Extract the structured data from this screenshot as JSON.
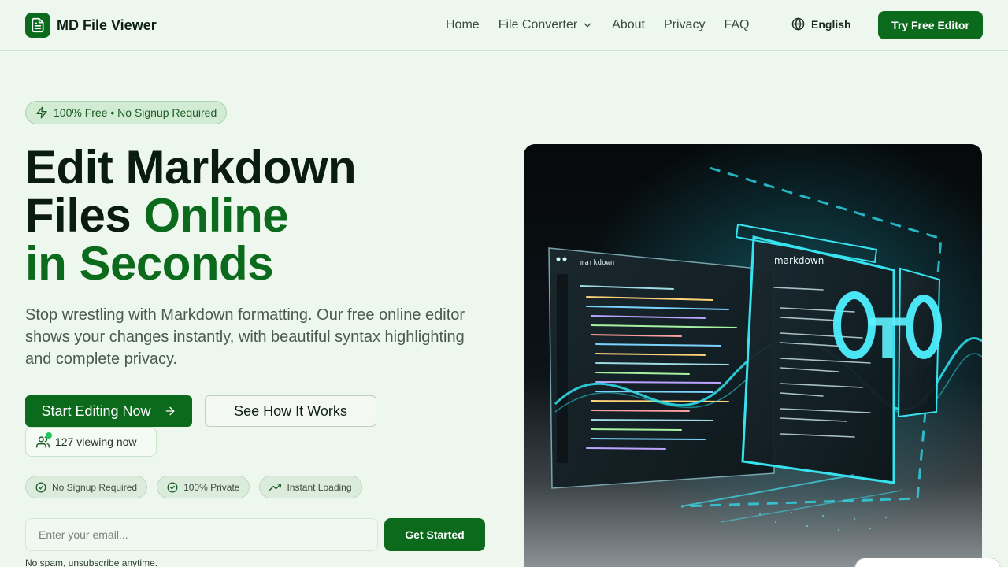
{
  "header": {
    "brand": "MD File Viewer",
    "nav": [
      {
        "label": "Home"
      },
      {
        "label": "File Converter",
        "has_dropdown": true
      },
      {
        "label": "About"
      },
      {
        "label": "Privacy"
      },
      {
        "label": "FAQ"
      }
    ],
    "language": "English",
    "cta": "Try Free Editor"
  },
  "hero": {
    "badge": "100% Free • No Signup Required",
    "headline_1": "Edit Markdown",
    "headline_2a": "Files ",
    "headline_2b": "Online",
    "headline_3": "in Seconds",
    "subtitle": "Stop wrestling with Markdown formatting. Our free online editor shows your changes instantly, with beautiful syntax highlighting and complete privacy.",
    "primary_button": "Start Editing Now",
    "secondary_button": "See How It Works",
    "viewing": "127 viewing now",
    "pills": [
      "No Signup Required",
      "100% Private",
      "Instant Loading"
    ],
    "email_placeholder": "Enter your email...",
    "email_button": "Get Started",
    "disclaimer": "No spam, unsubscribe anytime."
  },
  "illustration": {
    "window_title": "markdown",
    "panel_title": "markdown"
  },
  "colors": {
    "brand": "#0b6a1c",
    "background": "#eef7ee",
    "glow": "#39e6f2"
  }
}
